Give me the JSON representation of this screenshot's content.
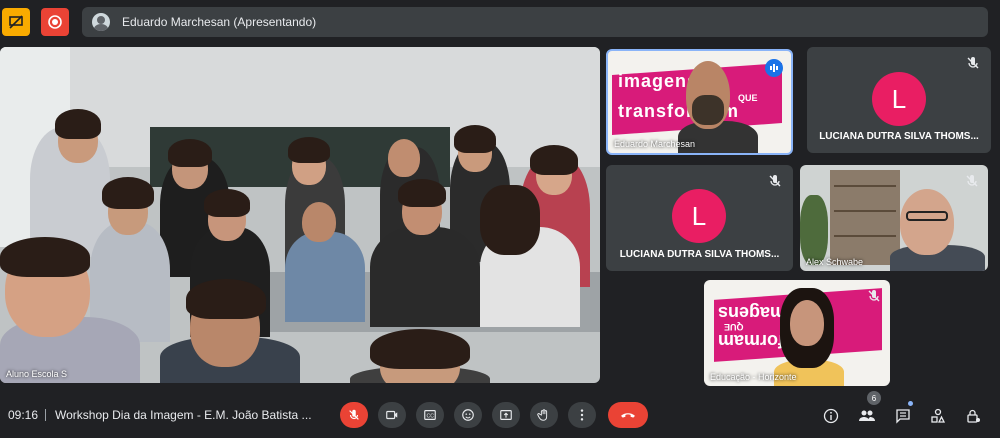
{
  "top": {
    "presenting_text": "Eduardo Marchesan (Apresentando)"
  },
  "tiles": {
    "main": {
      "label": "Aluno Escola S"
    },
    "eduardo": {
      "label": "Eduardo Marchesan",
      "banner_line1": "imagens",
      "banner_line2": "QUE",
      "banner_line3": "transformam"
    },
    "luciana1": {
      "initial": "L",
      "name": "LUCIANA DUTRA SILVA THOMS..."
    },
    "luciana2": {
      "initial": "L",
      "name": "LUCIANA DUTRA SILVA THOMS..."
    },
    "alex": {
      "label": "Alex Schwabe"
    },
    "educacao": {
      "label": "Educação - Horizonte",
      "banner_line1": "imagens",
      "banner_line2": "QUE",
      "banner_line3": "transformam"
    }
  },
  "bottom": {
    "time": "09:16",
    "meeting_title": "Workshop Dia da Imagem - E.M. João Batista ...",
    "participants_count": "6"
  },
  "colors": {
    "background": "#202124",
    "tile": "#3c4043",
    "accent_red": "#ea4335",
    "avatar_pink": "#e91e63",
    "active_border": "#8ab4f8",
    "warning_yellow": "#f9ab00"
  }
}
